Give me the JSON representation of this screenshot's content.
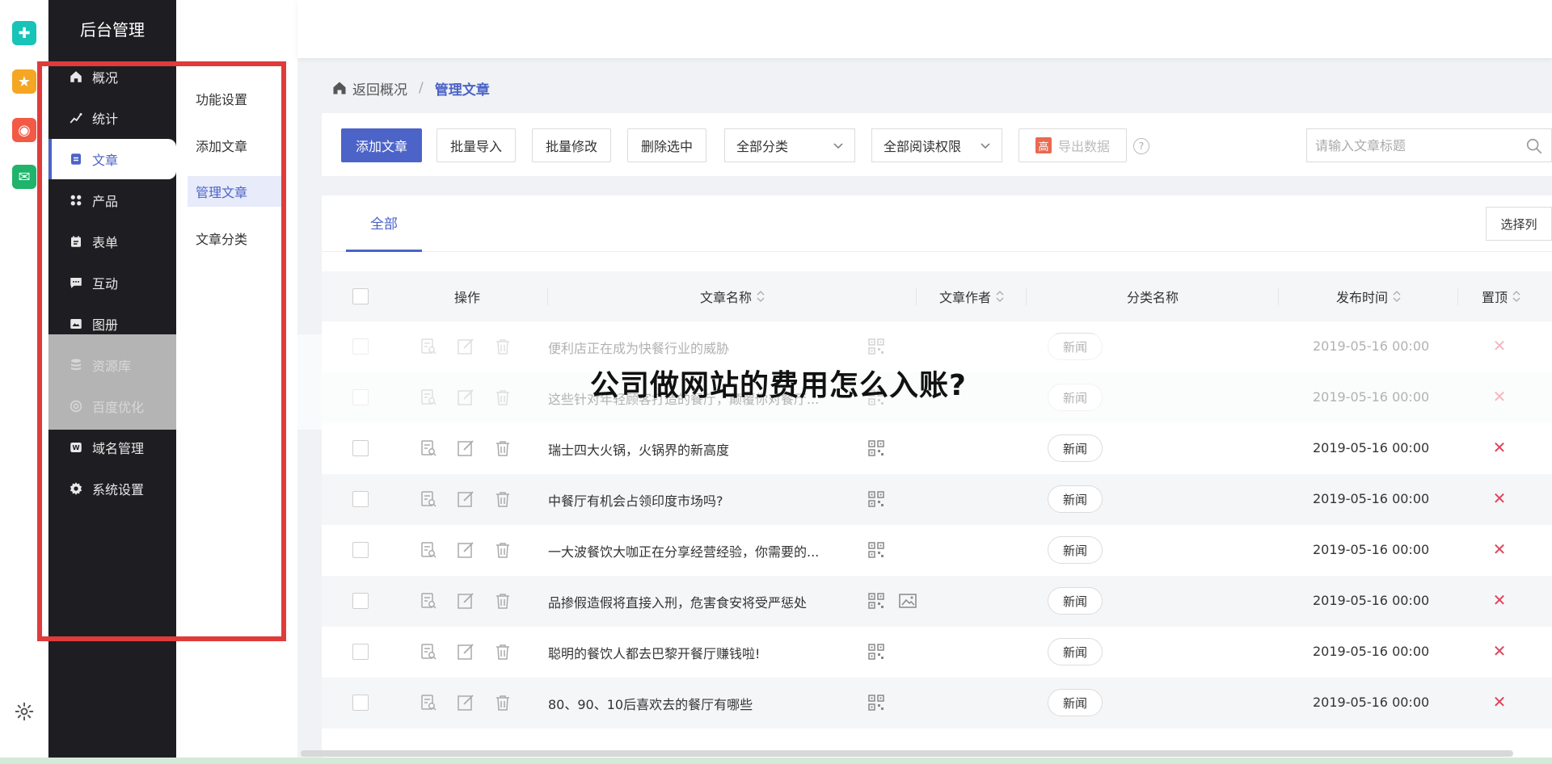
{
  "brand": "后台管理",
  "rail": [
    {
      "name": "plugin-app",
      "color": "#18c3b8",
      "glyph": "✚"
    },
    {
      "name": "favorite-app",
      "color": "#f5a623",
      "glyph": "★"
    },
    {
      "name": "weibo-app",
      "color": "#f25a45",
      "glyph": "◉"
    },
    {
      "name": "mail-app",
      "color": "#1fb36b",
      "glyph": "✉"
    }
  ],
  "nav": {
    "items": [
      {
        "label": "概况",
        "icon": "home-icon"
      },
      {
        "label": "统计",
        "icon": "chart-icon"
      },
      {
        "label": "文章",
        "icon": "article-icon",
        "active": true
      },
      {
        "label": "产品",
        "icon": "grid-icon"
      },
      {
        "label": "表单",
        "icon": "form-icon"
      },
      {
        "label": "互动",
        "icon": "chat-icon"
      },
      {
        "label": "图册",
        "icon": "album-icon"
      },
      {
        "label": "资源库",
        "icon": "database-icon"
      },
      {
        "label": "百度优化",
        "icon": "seo-icon"
      },
      {
        "label": "域名管理",
        "icon": "domain-icon"
      },
      {
        "label": "系统设置",
        "icon": "gear-icon"
      }
    ]
  },
  "submenu": {
    "items": [
      {
        "label": "功能设置"
      },
      {
        "label": "添加文章"
      },
      {
        "label": "管理文章",
        "active": true
      },
      {
        "label": "文章分类"
      }
    ]
  },
  "breadcrumb": {
    "back": "返回概况",
    "sep": "/",
    "current": "管理文章"
  },
  "toolbar": {
    "add": "添加文章",
    "import": "批量导入",
    "batch_edit": "批量修改",
    "delete_selected": "删除选中",
    "category_select": "全部分类",
    "permission_select": "全部阅读权限",
    "export_badge": "高",
    "export": "导出数据",
    "help": "?",
    "search_placeholder": "请输入文章标题"
  },
  "tabs": {
    "all": "全部",
    "select_columns": "选择列"
  },
  "table": {
    "headers": {
      "ops": "操作",
      "title": "文章名称",
      "author": "文章作者",
      "category": "分类名称",
      "date": "发布时间",
      "pin": "置顶"
    },
    "rows": [
      {
        "title": "便利店正在成为快餐行业的威胁",
        "tag": "新闻",
        "date": "2019-05-16 00:00",
        "image": false
      },
      {
        "title": "这些针对年轻顾客打造的餐厅，颠覆你对餐厅...",
        "tag": "新闻",
        "date": "2019-05-16 00:00",
        "image": false
      },
      {
        "title": "瑞士四大火锅，火锅界的新高度",
        "tag": "新闻",
        "date": "2019-05-16 00:00",
        "image": false
      },
      {
        "title": "中餐厅有机会占领印度市场吗?",
        "tag": "新闻",
        "date": "2019-05-16 00:00",
        "image": false
      },
      {
        "title": "一大波餐饮大咖正在分享经营经验，你需要的...",
        "tag": "新闻",
        "date": "2019-05-16 00:00",
        "image": false
      },
      {
        "title": "品掺假造假将直接入刑，危害食安将受严惩处",
        "tag": "新闻",
        "date": "2019-05-16 00:00",
        "image": true
      },
      {
        "title": "聪明的餐饮人都去巴黎开餐厅赚钱啦!",
        "tag": "新闻",
        "date": "2019-05-16 00:00",
        "image": false
      },
      {
        "title": "80、90、10后喜欢去的餐厅有哪些",
        "tag": "新闻",
        "date": "2019-05-16 00:00",
        "image": false
      }
    ]
  },
  "overlay_title": "公司做网站的费用怎么入账?",
  "colors": {
    "accent": "#4c63c7",
    "danger": "#e0435a",
    "highlight": "#e03b3b",
    "nav_bg": "#1e1e22"
  }
}
